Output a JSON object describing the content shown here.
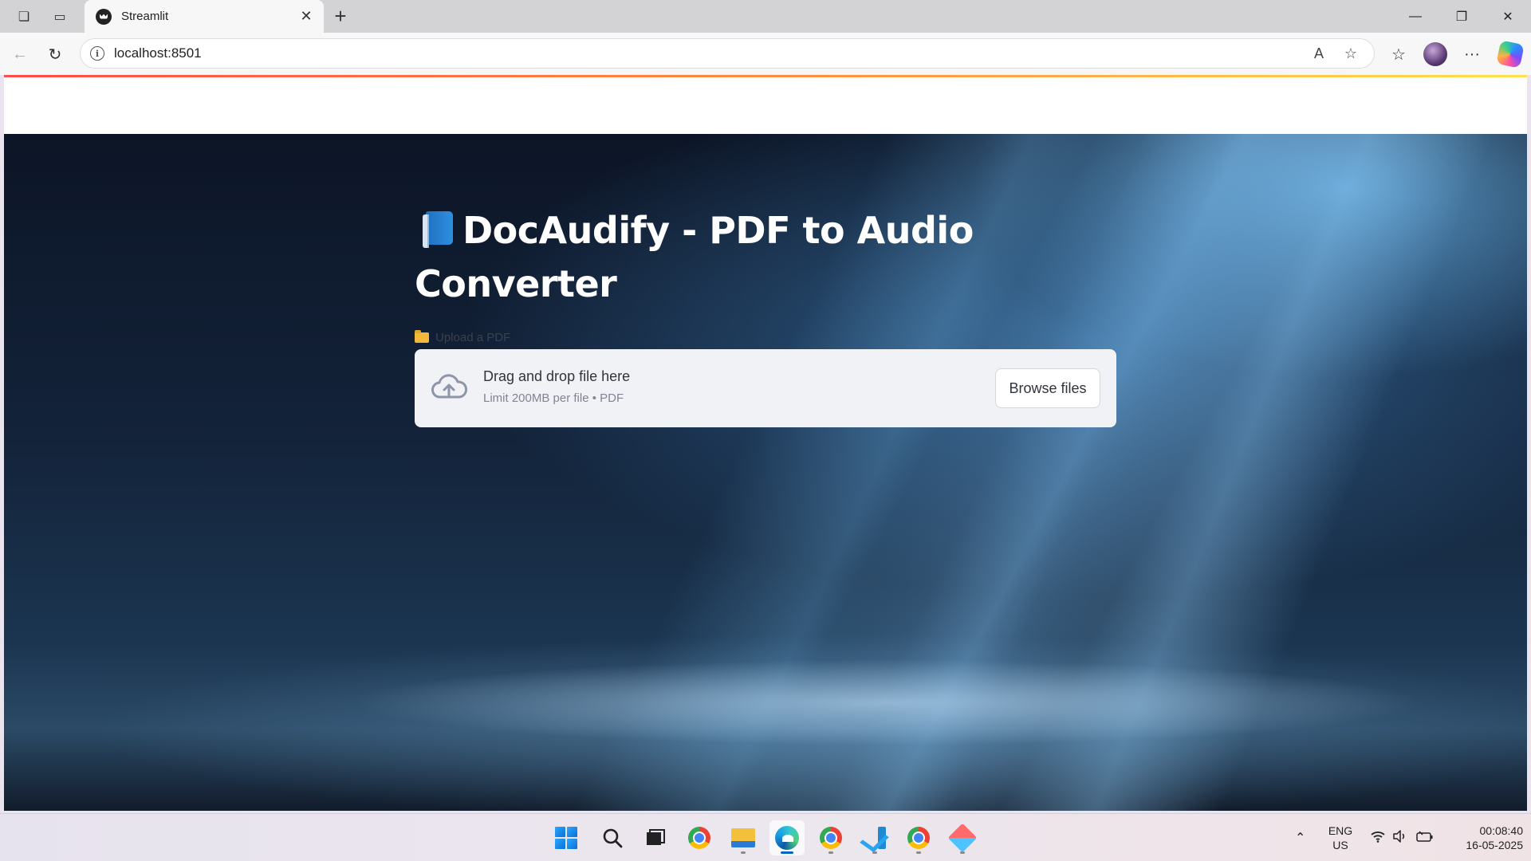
{
  "browser": {
    "tab_title": "Streamlit",
    "url": "localhost:8501"
  },
  "page": {
    "title": "DocAudify - PDF to Audio Converter",
    "upload_label": "Upload a PDF",
    "dropzone_main": "Drag and drop file here",
    "dropzone_sub": "Limit 200MB per file • PDF",
    "browse_button": "Browse files"
  },
  "taskbar": {
    "apps": [
      "start",
      "search",
      "task-view",
      "chrome",
      "file-explorer",
      "edge",
      "chrome-profile",
      "vscode",
      "chrome-profile-2",
      "kite"
    ],
    "language_line1": "ENG",
    "language_line2": "US",
    "time": "00:08:40",
    "date": "16-05-2025"
  },
  "colors": {
    "accent_line_start": "#ff4b4b",
    "accent_line_end": "#ffe14f",
    "dropzone_bg": "#f0f2f6",
    "title_color": "#ffffff"
  }
}
